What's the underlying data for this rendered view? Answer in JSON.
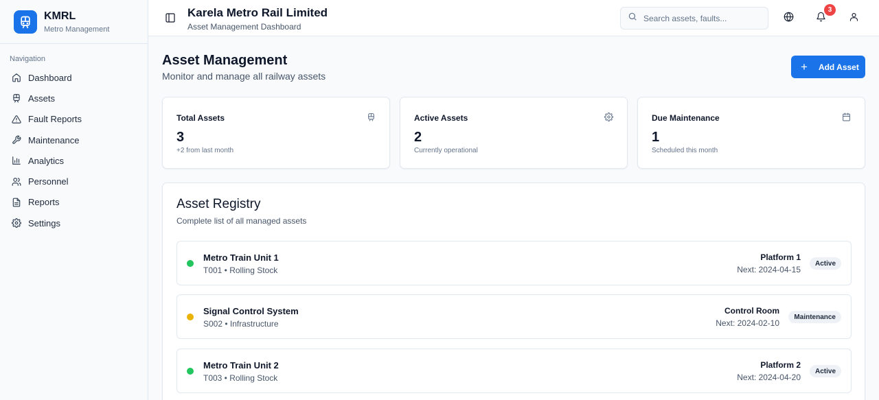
{
  "sidebar": {
    "brand_name": "KMRL",
    "brand_sub": "Metro Management",
    "nav_heading": "Navigation",
    "items": [
      {
        "label": "Dashboard",
        "icon": "home-icon"
      },
      {
        "label": "Assets",
        "icon": "train-icon"
      },
      {
        "label": "Fault Reports",
        "icon": "alert-triangle-icon"
      },
      {
        "label": "Maintenance",
        "icon": "wrench-icon"
      },
      {
        "label": "Analytics",
        "icon": "bar-chart-icon"
      },
      {
        "label": "Personnel",
        "icon": "users-icon"
      },
      {
        "label": "Reports",
        "icon": "file-text-icon"
      },
      {
        "label": "Settings",
        "icon": "gear-icon"
      }
    ]
  },
  "header": {
    "title": "Karela Metro Rail Limited",
    "subtitle": "Asset Management Dashboard",
    "search_placeholder": "Search assets, faults...",
    "notification_count": "3"
  },
  "main": {
    "title": "Asset Management",
    "subtitle": "Monitor and manage all railway assets",
    "add_button_label": "Add Asset",
    "stats": [
      {
        "label": "Total Assets",
        "value": "3",
        "note": "+2 from last month",
        "icon": "train-icon"
      },
      {
        "label": "Active Assets",
        "value": "2",
        "note": "Currently operational",
        "icon": "gear-icon"
      },
      {
        "label": "Due Maintenance",
        "value": "1",
        "note": "Scheduled this month",
        "icon": "calendar-icon"
      }
    ],
    "registry": {
      "title": "Asset Registry",
      "subtitle": "Complete list of all managed assets",
      "assets": [
        {
          "name": "Metro Train Unit 1",
          "meta": "T001 • Rolling Stock",
          "location": "Platform 1",
          "next": "Next: 2024-04-15",
          "status": "Active",
          "status_color": "#22c55e"
        },
        {
          "name": "Signal Control System",
          "meta": "S002 • Infrastructure",
          "location": "Control Room",
          "next": "Next: 2024-02-10",
          "status": "Maintenance",
          "status_color": "#eab308"
        },
        {
          "name": "Metro Train Unit 2",
          "meta": "T003 • Rolling Stock",
          "location": "Platform 2",
          "next": "Next: 2024-04-20",
          "status": "Active",
          "status_color": "#22c55e"
        }
      ]
    }
  },
  "colors": {
    "accent": "#1a73e8",
    "active": "#22c55e",
    "maintenance": "#eab308",
    "badge": "#ef4444"
  }
}
